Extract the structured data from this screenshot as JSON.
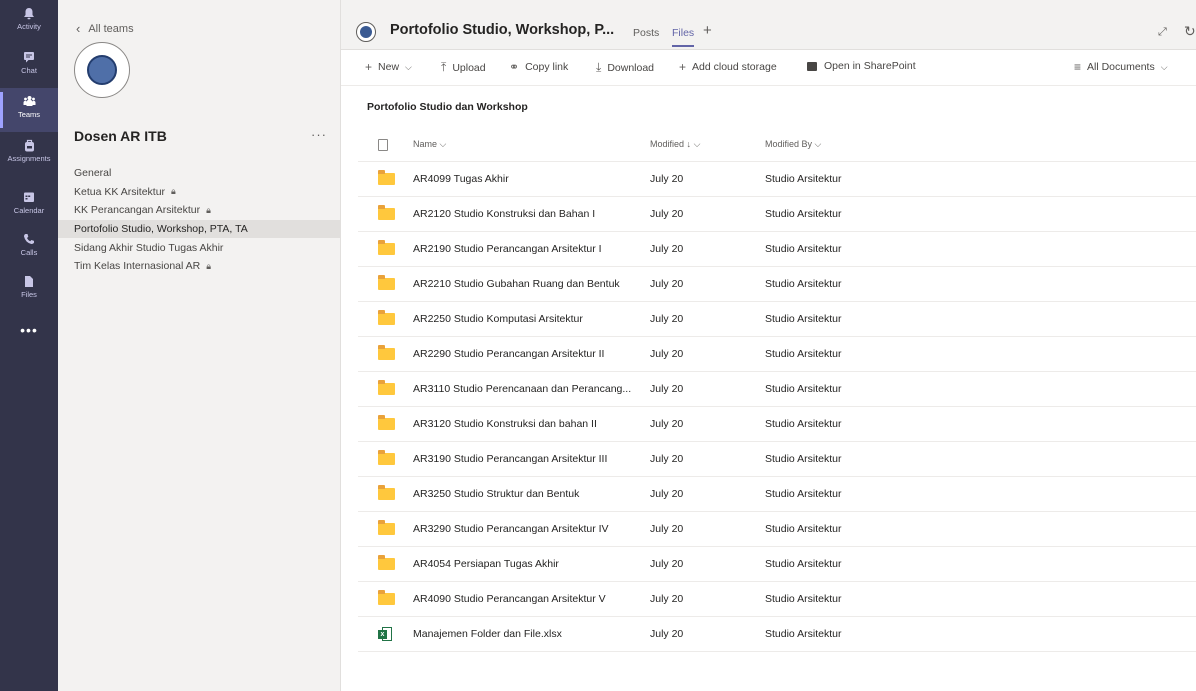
{
  "rail": {
    "items": [
      {
        "label": "Activity",
        "icon": "bell-icon"
      },
      {
        "label": "Chat",
        "icon": "chat-icon"
      },
      {
        "label": "Teams",
        "icon": "teams-icon"
      },
      {
        "label": "Assignments",
        "icon": "backpack-icon"
      },
      {
        "label": "Calendar",
        "icon": "calendar-icon"
      },
      {
        "label": "Calls",
        "icon": "phone-icon"
      },
      {
        "label": "Files",
        "icon": "file-icon"
      }
    ],
    "more": "•••"
  },
  "teampanel": {
    "back_label": "All teams",
    "team_name": "Dosen AR ITB",
    "more": "···",
    "channels": [
      {
        "label": "General",
        "private": false
      },
      {
        "label": "Ketua KK Arsitektur",
        "private": true
      },
      {
        "label": "KK Perancangan Arsitektur",
        "private": true
      },
      {
        "label": "Portofolio Studio, Workshop, PTA, TA",
        "private": false
      },
      {
        "label": "Sidang Akhir Studio Tugas Akhir",
        "private": false
      },
      {
        "label": "Tim Kelas Internasional AR",
        "private": true
      }
    ]
  },
  "header": {
    "title": "Portofolio Studio, Workshop, P...",
    "tabs": [
      "Posts",
      "Files"
    ],
    "active_tab": "Files",
    "add_tab": "+"
  },
  "toolbar": {
    "new": "New",
    "upload": "Upload",
    "copy_link": "Copy link",
    "download": "Download",
    "add_cloud": "Add cloud storage",
    "open_sharepoint": "Open in SharePoint",
    "view": "All Documents"
  },
  "breadcrumb": "Portofolio Studio dan Workshop",
  "table": {
    "columns": {
      "name": "Name",
      "modified": "Modified",
      "modified_by": "Modified By"
    },
    "rows": [
      {
        "type": "folder",
        "name": "AR4099 Tugas Akhir",
        "modified": "July 20",
        "by": "Studio Arsitektur"
      },
      {
        "type": "folder",
        "name": "AR2120 Studio Konstruksi dan Bahan I",
        "modified": "July 20",
        "by": "Studio Arsitektur"
      },
      {
        "type": "folder",
        "name": "AR2190 Studio Perancangan Arsitektur I",
        "modified": "July 20",
        "by": "Studio Arsitektur"
      },
      {
        "type": "folder",
        "name": "AR2210 Studio Gubahan Ruang dan Bentuk",
        "modified": "July 20",
        "by": "Studio Arsitektur"
      },
      {
        "type": "folder",
        "name": "AR2250 Studio Komputasi Arsitektur",
        "modified": "July 20",
        "by": "Studio Arsitektur"
      },
      {
        "type": "folder",
        "name": "AR2290 Studio Perancangan Arsitektur II",
        "modified": "July 20",
        "by": "Studio Arsitektur"
      },
      {
        "type": "folder",
        "name": "AR3110 Studio Perencanaan dan Perancang...",
        "modified": "July 20",
        "by": "Studio Arsitektur"
      },
      {
        "type": "folder",
        "name": "AR3120 Studio Konstruksi dan bahan II",
        "modified": "July 20",
        "by": "Studio Arsitektur"
      },
      {
        "type": "folder",
        "name": "AR3190 Studio Perancangan Arsitektur III",
        "modified": "July 20",
        "by": "Studio Arsitektur"
      },
      {
        "type": "folder",
        "name": "AR3250 Studio Struktur dan Bentuk",
        "modified": "July 20",
        "by": "Studio Arsitektur"
      },
      {
        "type": "folder",
        "name": "AR3290 Studio Perancangan Arsitektur IV",
        "modified": "July 20",
        "by": "Studio Arsitektur"
      },
      {
        "type": "folder",
        "name": "AR4054 Persiapan Tugas Akhir",
        "modified": "July 20",
        "by": "Studio Arsitektur"
      },
      {
        "type": "folder",
        "name": "AR4090 Studio Perancangan Arsitektur V",
        "modified": "July 20",
        "by": "Studio Arsitektur"
      },
      {
        "type": "xlsx",
        "name": "Manajemen Folder dan File.xlsx",
        "modified": "July 20",
        "by": "Studio Arsitektur"
      }
    ]
  }
}
